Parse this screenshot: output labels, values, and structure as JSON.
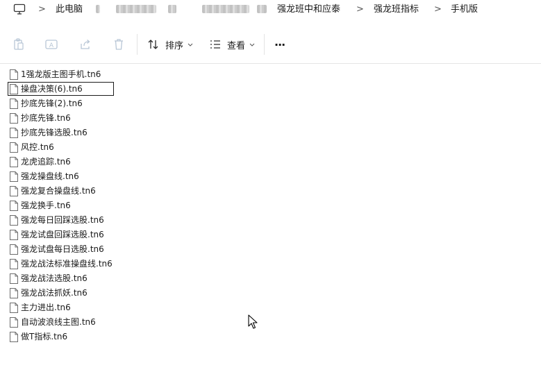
{
  "breadcrumb": {
    "items": [
      "此电脑",
      "强龙班中和应泰",
      "强龙班指标",
      "手机版"
    ],
    "separator": ">"
  },
  "toolbar": {
    "sort_label": "排序",
    "view_label": "查看",
    "more_label": "···"
  },
  "files": [
    "1强龙版主图手机.tn6",
    "操盘决策(6).tn6",
    "抄底先锋(2).tn6",
    "抄底先锋.tn6",
    "抄底先锋选股.tn6",
    "风控.tn6",
    "龙虎追踪.tn6",
    "强龙操盘线.tn6",
    "强龙复合操盘线.tn6",
    "强龙换手.tn6",
    "强龙每日回踩选股.tn6",
    "强龙试盘回踩选股.tn6",
    "强龙试盘每日选股.tn6",
    "强龙战法标准操盘线.tn6",
    "强龙战法选股.tn6",
    "强龙战法抓妖.tn6",
    "主力进出.tn6",
    "自动波浪线主图.tn6",
    "做T指标.tn6"
  ],
  "selected_file": "操盘决策(6).tn6"
}
